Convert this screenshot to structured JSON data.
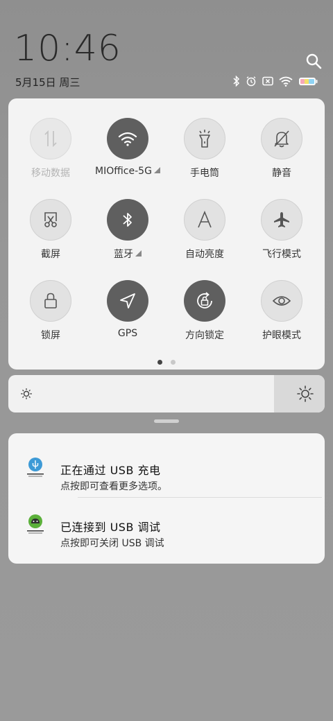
{
  "status": {
    "time": "10:46",
    "date": "5月15日 周三"
  },
  "quick_settings": {
    "tiles": [
      {
        "label": "移动数据",
        "icon": "mobile-data-icon",
        "state": "disabled"
      },
      {
        "label": "MIOffice-5G",
        "icon": "wifi-icon",
        "state": "on"
      },
      {
        "label": "手电筒",
        "icon": "flashlight-icon",
        "state": "off"
      },
      {
        "label": "静音",
        "icon": "mute-bell-icon",
        "state": "off"
      },
      {
        "label": "截屏",
        "icon": "screenshot-icon",
        "state": "off"
      },
      {
        "label": "蓝牙",
        "icon": "bluetooth-icon",
        "state": "on"
      },
      {
        "label": "自动亮度",
        "icon": "auto-brightness-icon",
        "state": "off"
      },
      {
        "label": "飞行模式",
        "icon": "airplane-icon",
        "state": "off"
      },
      {
        "label": "锁屏",
        "icon": "lock-icon",
        "state": "off"
      },
      {
        "label": "GPS",
        "icon": "gps-icon",
        "state": "on"
      },
      {
        "label": "方向锁定",
        "icon": "rotation-lock-icon",
        "state": "on"
      },
      {
        "label": "护眼模式",
        "icon": "eye-icon",
        "state": "off"
      }
    ],
    "page_index": 1,
    "page_count": 2
  },
  "brightness": {
    "level": 0.84
  },
  "notifications": [
    {
      "title": "正在通过 USB 充电",
      "subtitle": "点按即可查看更多选项。",
      "icon": "usb-icon"
    },
    {
      "title": "已连接到 USB 调试",
      "subtitle": "点按即可关闭 USB 调试",
      "icon": "android-icon"
    }
  ],
  "colors": {
    "tile_on": "#5f5f5f",
    "tile_off": "#e2e2e2",
    "usb_icon": "#3d9ad6",
    "android_icon": "#5bb03a"
  }
}
